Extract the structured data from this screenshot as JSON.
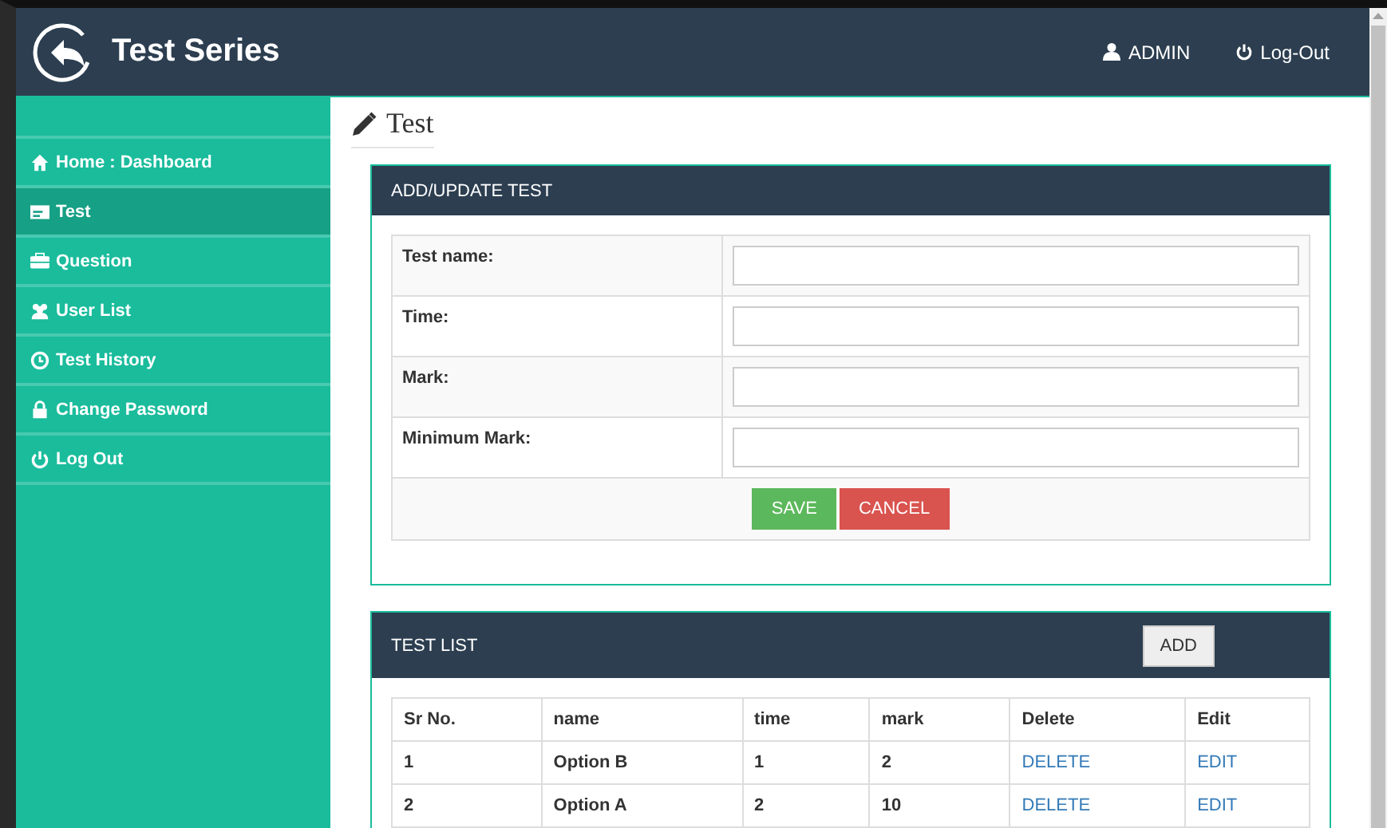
{
  "header": {
    "title": "Test Series",
    "user": "ADMIN",
    "logout": "Log-Out"
  },
  "sidebar": {
    "items": [
      {
        "label": "Home : Dashboard",
        "kind": "home",
        "selected": false
      },
      {
        "label": "Test",
        "kind": "list",
        "selected": true
      },
      {
        "label": "Question",
        "kind": "case",
        "selected": false
      },
      {
        "label": "User List",
        "kind": "users",
        "selected": false
      },
      {
        "label": "Test History",
        "kind": "clock",
        "selected": false
      },
      {
        "label": "Change Password",
        "kind": "lock",
        "selected": false
      },
      {
        "label": "Log Out",
        "kind": "power",
        "selected": false
      }
    ]
  },
  "page": {
    "title": "Test"
  },
  "form": {
    "title": "ADD/UPDATE TEST",
    "fields": [
      {
        "label": "Test name:"
      },
      {
        "label": "Time:"
      },
      {
        "label": "Mark:"
      },
      {
        "label": "Minimum Mark:"
      }
    ],
    "buttons": [
      {
        "label": "SAVE",
        "kind": "success"
      },
      {
        "label": "CANCEL",
        "kind": "danger"
      }
    ]
  },
  "list": {
    "title": "TEST LIST",
    "add": "ADD",
    "columns": [
      "Sr No.",
      "name",
      "time",
      "mark",
      "Delete",
      "Edit"
    ],
    "rows": [
      {
        "cells": [
          "1",
          "Option B",
          "1",
          "2"
        ],
        "delete": "DELETE",
        "edit": "EDIT"
      },
      {
        "cells": [
          "2",
          "Option A",
          "2",
          "10"
        ],
        "delete": "DELETE",
        "edit": "EDIT"
      }
    ]
  }
}
